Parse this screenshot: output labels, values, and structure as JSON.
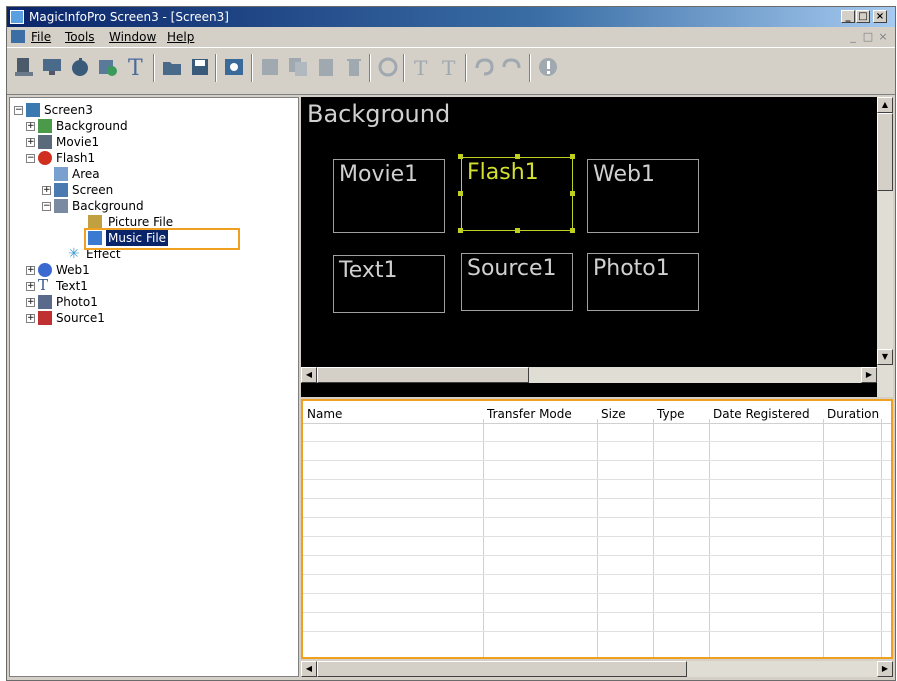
{
  "window": {
    "title": "MagicInfoPro Screen3 - [Screen3]",
    "caption_buttons": [
      "_",
      "□",
      "×"
    ],
    "mdi_buttons": [
      "_",
      "□",
      "×"
    ]
  },
  "menu": {
    "items": [
      {
        "label": "File"
      },
      {
        "label": "Tools"
      },
      {
        "label": "Window"
      },
      {
        "label": "Help"
      }
    ]
  },
  "toolbar": {
    "icons": [
      "new-screen-icon",
      "monitor-icon",
      "clock-icon",
      "settings-icon",
      "text-icon",
      "open-folder-icon",
      "save-icon",
      "preview-icon",
      "add-content-icon",
      "copy-content-icon",
      "paste-content-icon",
      "delete-icon",
      "rotate-icon",
      "align-left-icon",
      "align-right-icon",
      "undo-icon",
      "redo-icon",
      "info-icon"
    ]
  },
  "tree": {
    "root": "Screen3",
    "items": [
      {
        "label": "Background"
      },
      {
        "label": "Movie1"
      },
      {
        "label": "Flash1"
      },
      {
        "label": "Area"
      },
      {
        "label": "Screen"
      },
      {
        "label": "Background"
      },
      {
        "label": "Picture File"
      },
      {
        "label": "Music File"
      },
      {
        "label": "Effect"
      },
      {
        "label": "Web1"
      },
      {
        "label": "Text1"
      },
      {
        "label": "Photo1"
      },
      {
        "label": "Source1"
      }
    ]
  },
  "preview": {
    "title": "Background",
    "boxes": [
      {
        "label": "Movie1"
      },
      {
        "label": "Flash1"
      },
      {
        "label": "Web1"
      },
      {
        "label": "Text1"
      },
      {
        "label": "Source1"
      },
      {
        "label": "Photo1"
      }
    ],
    "accent": "#d4e030"
  },
  "file_table": {
    "columns": [
      "Name",
      "Transfer Mode",
      "Size",
      "Type",
      "Date Registered",
      "Duration"
    ],
    "rows": []
  },
  "highlight_color": "#f0a020"
}
